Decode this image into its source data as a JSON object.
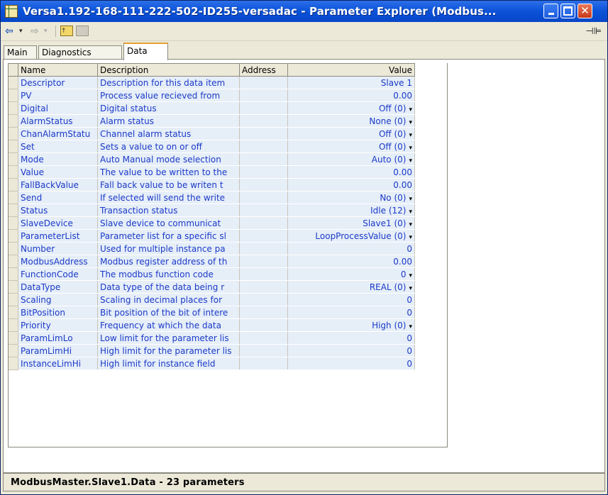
{
  "window": {
    "title": "Versa1.192-168-111-222-502-ID255-versadac - Parameter Explorer (Modbus...",
    "close_glyph": "✕"
  },
  "toolbar": {
    "back_glyph": "⇦",
    "forward_glyph": "⇨",
    "dropdown_glyph": "▾",
    "up_folder_glyph": "↑",
    "pin_glyph": "⊣⊫"
  },
  "tabs": [
    {
      "label": "Main"
    },
    {
      "label": "Diagnostics"
    },
    {
      "label": "Data"
    }
  ],
  "grid": {
    "columns": [
      "Name",
      "Description",
      "Address",
      "Value"
    ],
    "rows": [
      {
        "name": "Descriptor",
        "description": "Description for this data item",
        "address": "",
        "value": "Slave 1",
        "dropdown": false
      },
      {
        "name": "PV",
        "description": "Process value recieved from",
        "address": "",
        "value": "0.00",
        "dropdown": false
      },
      {
        "name": "Digital",
        "description": "Digital status",
        "address": "",
        "value": "Off (0)",
        "dropdown": true
      },
      {
        "name": "AlarmStatus",
        "description": "Alarm status",
        "address": "",
        "value": "None (0)",
        "dropdown": true
      },
      {
        "name": "ChanAlarmStatu",
        "description": "Channel alarm status",
        "address": "",
        "value": "Off (0)",
        "dropdown": true
      },
      {
        "name": "Set",
        "description": "Sets a value to on or off",
        "address": "",
        "value": "Off (0)",
        "dropdown": true
      },
      {
        "name": "Mode",
        "description": "Auto Manual mode selection",
        "address": "",
        "value": "Auto (0)",
        "dropdown": true
      },
      {
        "name": "Value",
        "description": "The value to be written to the",
        "address": "",
        "value": "0.00",
        "dropdown": false
      },
      {
        "name": "FallBackValue",
        "description": "Fall back value to be writen t",
        "address": "",
        "value": "0.00",
        "dropdown": false
      },
      {
        "name": "Send",
        "description": "If selected will send the write",
        "address": "",
        "value": "No (0)",
        "dropdown": true
      },
      {
        "name": "Status",
        "description": "Transaction status",
        "address": "",
        "value": "Idle (12)",
        "dropdown": true
      },
      {
        "name": "SlaveDevice",
        "description": "Slave device to communicat",
        "address": "",
        "value": "Slave1 (0)",
        "dropdown": true
      },
      {
        "name": "ParameterList",
        "description": "Parameter list for a specific sl",
        "address": "",
        "value": "LoopProcessValue (0)",
        "dropdown": true
      },
      {
        "name": "Number",
        "description": "Used for multiple instance pa",
        "address": "",
        "value": "0",
        "dropdown": false
      },
      {
        "name": "ModbusAddress",
        "description": "Modbus register address of th",
        "address": "",
        "value": "0.00",
        "dropdown": false
      },
      {
        "name": "FunctionCode",
        "description": "The modbus function code",
        "address": "",
        "value": "0",
        "dropdown": true
      },
      {
        "name": "DataType",
        "description": "Data type of the data being r",
        "address": "",
        "value": "REAL (0)",
        "dropdown": true
      },
      {
        "name": "Scaling",
        "description": "Scaling in decimal places for",
        "address": "",
        "value": "0",
        "dropdown": false
      },
      {
        "name": "BitPosition",
        "description": "Bit position of the bit of intere",
        "address": "",
        "value": "0",
        "dropdown": false
      },
      {
        "name": "Priority",
        "description": "Frequency at which the data",
        "address": "",
        "value": "High (0)",
        "dropdown": true
      },
      {
        "name": "ParamLimLo",
        "description": "Low limit for the parameter lis",
        "address": "",
        "value": "0",
        "dropdown": false
      },
      {
        "name": "ParamLimHi",
        "description": "High limit for the parameter lis",
        "address": "",
        "value": "0",
        "dropdown": false
      },
      {
        "name": "InstanceLimHi",
        "description": "High limit for instance field",
        "address": "",
        "value": "0",
        "dropdown": false
      }
    ]
  },
  "status": {
    "text": "ModbusMaster.Slave1.Data  -  23 parameters"
  },
  "colors": {
    "titlebar": "#0a52d8",
    "link_text": "#1a3ac8",
    "row_background": "#e6eef8",
    "active_tab_accent": "#e8a030"
  }
}
